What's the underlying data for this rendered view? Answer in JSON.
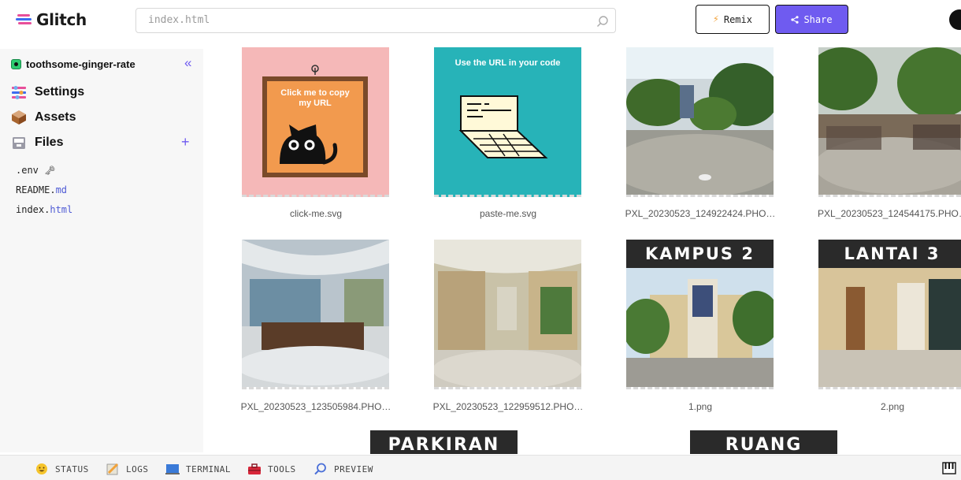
{
  "header": {
    "brand": "Glitch",
    "search_placeholder": "index.html",
    "remix_label": "Remix",
    "share_label": "Share"
  },
  "sidebar": {
    "project_name": "toothsome-ginger-rate",
    "nav": [
      {
        "label": "Settings",
        "icon": "settings-icon"
      },
      {
        "label": "Assets",
        "icon": "assets-icon"
      },
      {
        "label": "Files",
        "icon": "files-icon"
      }
    ],
    "files": [
      {
        "name": ".env",
        "ext": "",
        "suffix": "🗝"
      },
      {
        "name": "README.",
        "ext": "md"
      },
      {
        "name": "index.",
        "ext": "html"
      }
    ]
  },
  "assets": {
    "row1": [
      {
        "caption": "click-me.svg",
        "text": "Click me to copy my URL"
      },
      {
        "caption": "paste-me.svg",
        "text": "Use the URL in your code"
      },
      {
        "caption": "PXL_20230523_124922424.PHO…"
      },
      {
        "caption": "PXL_20230523_124544175.PHO…"
      }
    ],
    "row2": [
      {
        "caption": "PXL_20230523_123505984.PHO…"
      },
      {
        "caption": "PXL_20230523_122959512.PHO…"
      },
      {
        "caption": "1.png",
        "banner": "KAMPUS 2"
      },
      {
        "caption": "2.png",
        "banner": "LANTAI 3"
      }
    ],
    "row3": [
      {
        "banner": "PARKIRAN"
      },
      {
        "banner": "RUANG KELAS"
      }
    ]
  },
  "footer": {
    "items": [
      {
        "label": "STATUS",
        "icon": "status-icon"
      },
      {
        "label": "LOGS",
        "icon": "logs-icon"
      },
      {
        "label": "TERMINAL",
        "icon": "terminal-icon"
      },
      {
        "label": "TOOLS",
        "icon": "tools-icon"
      },
      {
        "label": "PREVIEW",
        "icon": "preview-icon"
      }
    ]
  },
  "colors": {
    "accent": "#6f5bf0",
    "sidebar_bg": "#f7f7f7",
    "click_me_bg": "#f5b8b8",
    "paste_me_bg": "#27b3b8"
  }
}
